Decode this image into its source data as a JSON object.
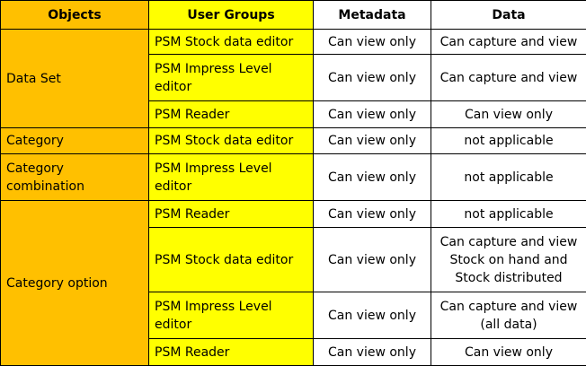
{
  "headers": {
    "objects": "Objects",
    "user_groups": "User Groups",
    "metadata": "Metadata",
    "data": "Data"
  },
  "objects": {
    "data_set": "Data Set",
    "category": "Category",
    "category_combination": "Category combination",
    "category_option": "Category option"
  },
  "rows": [
    {
      "group": "PSM Stock data editor",
      "metadata": "Can view only",
      "data": "Can capture and view"
    },
    {
      "group": "PSM Impress Level editor",
      "metadata": "Can view only",
      "data": "Can capture and view"
    },
    {
      "group": "PSM Reader",
      "metadata": "Can view only",
      "data": "Can view only"
    },
    {
      "group": "PSM Stock data editor",
      "metadata": "Can view only",
      "data": "not applicable"
    },
    {
      "group": "PSM Impress Level editor",
      "metadata": "Can view only",
      "data": "not applicable"
    },
    {
      "group": "PSM Reader",
      "metadata": "Can view only",
      "data": "not applicable"
    },
    {
      "group": "PSM Stock data editor",
      "metadata": "Can view only",
      "data": "Can capture and view Stock on hand and Stock distributed"
    },
    {
      "group": "PSM Impress Level editor",
      "metadata": "Can view only",
      "data": "Can capture and view (all data)"
    },
    {
      "group": "PSM Reader",
      "metadata": "Can view only",
      "data": "Can view only"
    }
  ],
  "colors": {
    "objects_column": "#FFC000",
    "user_groups_column": "#FFFF00"
  }
}
